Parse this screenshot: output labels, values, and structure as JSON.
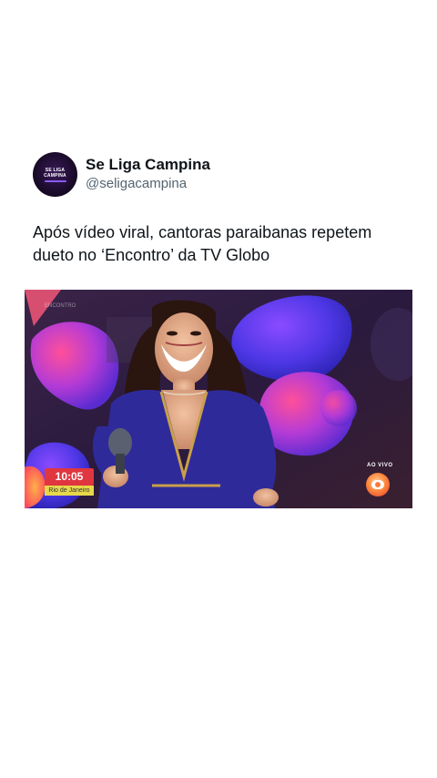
{
  "account": {
    "display_name": "Se Liga Campina",
    "handle": "@seligacampina",
    "avatar_text_line1": "SE LIGA",
    "avatar_text_line2": "CAMPINA"
  },
  "post": {
    "text": "Após vídeo viral, cantoras paraibanas repetem dueto no ‘Encontro’ da TV Globo"
  },
  "video_overlay": {
    "clock": "10:05",
    "date_strip": "Rio de Janeiro",
    "live_label": "AO VIVO",
    "watermark": "ENCONTRO",
    "logo_icon": "globo-logo-icon"
  },
  "colors": {
    "clock_badge": "#e0363f",
    "date_badge": "#e6d84a",
    "dress": "#2f2a9a",
    "handle_text": "#536471"
  }
}
